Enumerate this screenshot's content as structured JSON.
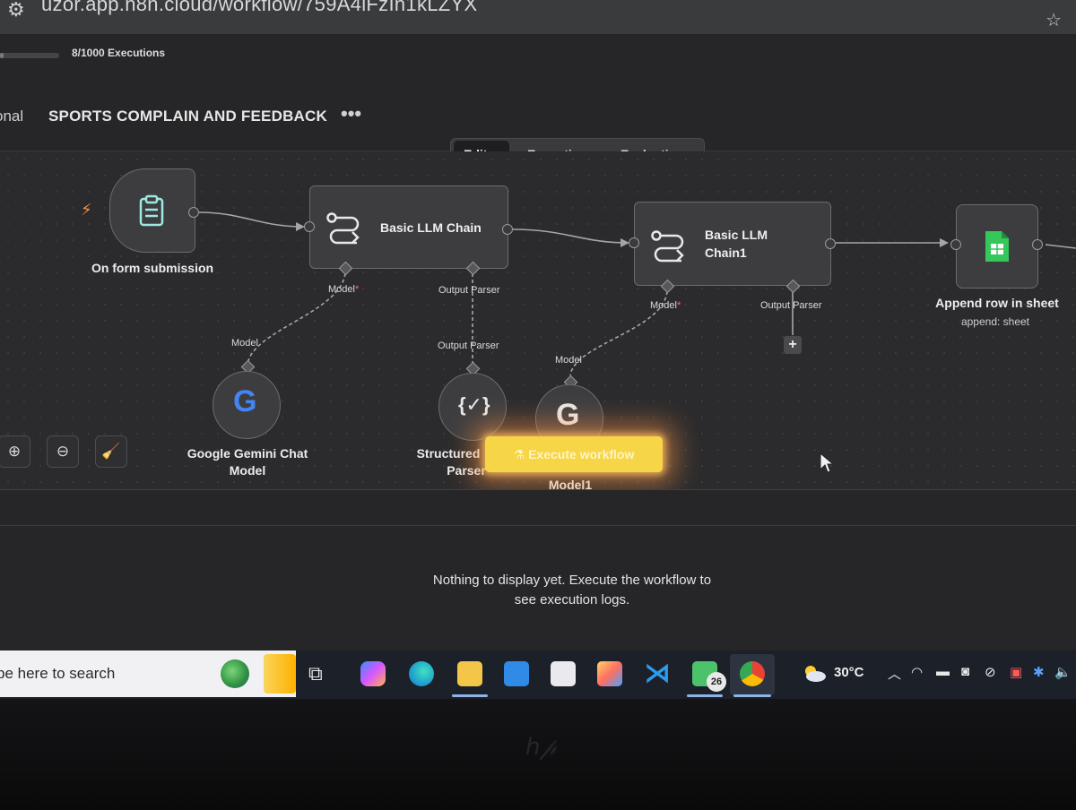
{
  "browser": {
    "url": "uzor.app.n8n.cloud/workflow/759A4iFzIn1kLZYX",
    "tune_icon": "tune-icon",
    "star_icon": "star-icon"
  },
  "execution_usage": {
    "label": "8/1000 Executions",
    "fraction": 0.008
  },
  "header": {
    "breadcrumb": "onal",
    "workflow_name": "SPORTS COMPLAIN AND FEEDBACK",
    "more": "•••"
  },
  "tabs": [
    {
      "label": "Editor",
      "active": true
    },
    {
      "label": "Executions",
      "active": false
    },
    {
      "label": "Evaluations",
      "active": false
    }
  ],
  "nodes": {
    "trigger": {
      "label": "On form submission"
    },
    "chain1": {
      "label": "Basic LLM Chain"
    },
    "chain2": {
      "label_line1": "Basic LLM",
      "label_line2": "Chain1"
    },
    "sheet": {
      "label": "Append row in sheet",
      "subtitle": "append: sheet"
    },
    "gemini1": {
      "label_line1": "Google Gemini Chat",
      "label_line2": "Model"
    },
    "parser": {
      "label_line1": "Structured",
      "label_line2": "Parser"
    },
    "gemini2": {
      "label": "Model1"
    }
  },
  "ports": {
    "model": "Model",
    "required_mark": "*",
    "output_parser": "Output Parser"
  },
  "execute_button": {
    "label": "Execute workflow"
  },
  "logs": {
    "empty_message": "Nothing to display yet. Execute the workflow to see execution logs."
  },
  "taskbar": {
    "search_placeholder": "pe here to search",
    "temperature": "30°C",
    "badge_count": "26"
  },
  "colors": {
    "accent_trigger": "#ff8f3a",
    "node_icon": "#9fe7e0",
    "sheet_green": "#34c759",
    "execute_yellow": "#f6d547",
    "required_red": "#ff6d6d"
  }
}
